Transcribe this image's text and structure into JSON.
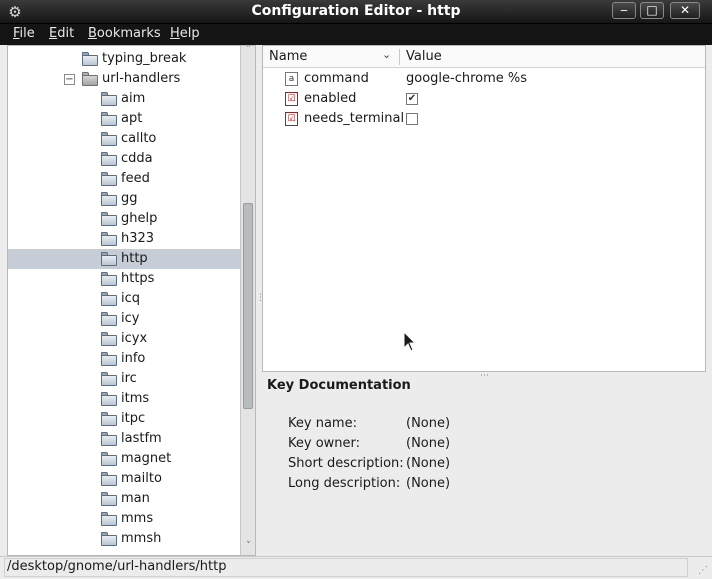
{
  "window": {
    "title": "Configuration Editor - http",
    "app_icon": "gear-icon",
    "controls": {
      "minimize": "‒",
      "maximize": "□",
      "close": "✕"
    }
  },
  "menubar": {
    "items": [
      {
        "mnemonic": "F",
        "rest": "ile"
      },
      {
        "mnemonic": "E",
        "rest": "dit"
      },
      {
        "mnemonic": "B",
        "rest": "ookmarks"
      },
      {
        "mnemonic": "H",
        "rest": "elp"
      }
    ]
  },
  "tree": {
    "items": [
      {
        "label": "typing_break",
        "level": 1,
        "icon": "folder-icon",
        "selected": false
      },
      {
        "label": "url-handlers",
        "level": 1,
        "icon": "folder-open-icon",
        "expanded": true,
        "expander": "−",
        "selected": false
      },
      {
        "label": "aim",
        "level": 2,
        "icon": "folder-icon",
        "selected": false
      },
      {
        "label": "apt",
        "level": 2,
        "icon": "folder-icon",
        "selected": false
      },
      {
        "label": "callto",
        "level": 2,
        "icon": "folder-icon",
        "selected": false
      },
      {
        "label": "cdda",
        "level": 2,
        "icon": "folder-icon",
        "selected": false
      },
      {
        "label": "feed",
        "level": 2,
        "icon": "folder-icon",
        "selected": false
      },
      {
        "label": "gg",
        "level": 2,
        "icon": "folder-icon",
        "selected": false
      },
      {
        "label": "ghelp",
        "level": 2,
        "icon": "folder-icon",
        "selected": false
      },
      {
        "label": "h323",
        "level": 2,
        "icon": "folder-icon",
        "selected": false
      },
      {
        "label": "http",
        "level": 2,
        "icon": "folder-icon",
        "selected": true
      },
      {
        "label": "https",
        "level": 2,
        "icon": "folder-icon",
        "selected": false
      },
      {
        "label": "icq",
        "level": 2,
        "icon": "folder-icon",
        "selected": false
      },
      {
        "label": "icy",
        "level": 2,
        "icon": "folder-icon",
        "selected": false
      },
      {
        "label": "icyx",
        "level": 2,
        "icon": "folder-icon",
        "selected": false
      },
      {
        "label": "info",
        "level": 2,
        "icon": "folder-icon",
        "selected": false
      },
      {
        "label": "irc",
        "level": 2,
        "icon": "folder-icon",
        "selected": false
      },
      {
        "label": "itms",
        "level": 2,
        "icon": "folder-icon",
        "selected": false
      },
      {
        "label": "itpc",
        "level": 2,
        "icon": "folder-icon",
        "selected": false
      },
      {
        "label": "lastfm",
        "level": 2,
        "icon": "folder-icon",
        "selected": false
      },
      {
        "label": "magnet",
        "level": 2,
        "icon": "folder-icon",
        "selected": false
      },
      {
        "label": "mailto",
        "level": 2,
        "icon": "folder-icon",
        "selected": false
      },
      {
        "label": "man",
        "level": 2,
        "icon": "folder-icon",
        "selected": false
      },
      {
        "label": "mms",
        "level": 2,
        "icon": "folder-icon",
        "selected": false
      },
      {
        "label": "mmsh",
        "level": 2,
        "icon": "folder-icon",
        "selected": false
      }
    ],
    "scroll_up": "˄",
    "scroll_down": "˅"
  },
  "keylist": {
    "columns": {
      "name": "Name",
      "value": "Value"
    },
    "sort_icon": "chevron-down-icon",
    "sort_glyph": "⌄",
    "rows": [
      {
        "name": "command",
        "type": "string",
        "icon_glyph": "a",
        "value": "google-chrome %s"
      },
      {
        "name": "enabled",
        "type": "bool",
        "icon_glyph": "☑",
        "checked": true,
        "check_glyph": "✔"
      },
      {
        "name": "needs_terminal",
        "type": "bool",
        "icon_glyph": "☑",
        "checked": false,
        "check_glyph": ""
      }
    ]
  },
  "documentation": {
    "title": "Key Documentation",
    "fields": [
      {
        "label": "Key name:",
        "value": "(None)"
      },
      {
        "label": "Key owner:",
        "value": "(None)"
      },
      {
        "label": "Short description:",
        "value": "(None)"
      },
      {
        "label": "Long description:",
        "value": "(None)"
      }
    ]
  },
  "statusbar": {
    "path": "/desktop/gnome/url-handlers/http"
  }
}
